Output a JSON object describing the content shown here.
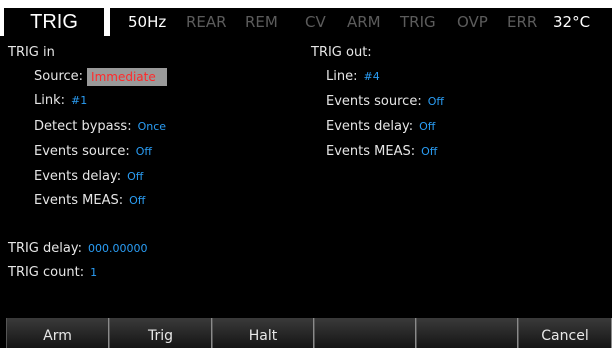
{
  "header": {
    "screen_title": "TRIG",
    "indicators": [
      {
        "label": "50Hz",
        "state": "on"
      },
      {
        "label": "REAR",
        "state": "off"
      },
      {
        "label": "REM",
        "state": "off"
      },
      {
        "label": "CV",
        "state": "off"
      },
      {
        "label": "ARM",
        "state": "off"
      },
      {
        "label": "TRIG",
        "state": "off"
      },
      {
        "label": "OVP",
        "state": "off"
      },
      {
        "label": "ERR",
        "state": "off"
      },
      {
        "label": "32°C",
        "state": "on"
      }
    ]
  },
  "trig_in": {
    "heading": "TRIG in",
    "source": {
      "label": "Source:",
      "value": "Immediate"
    },
    "link": {
      "label": "Link:",
      "value": "#1"
    },
    "detect_bypass": {
      "label": "Detect bypass:",
      "value": "Once"
    },
    "events_source": {
      "label": "Events source:",
      "value": "Off"
    },
    "events_delay": {
      "label": "Events delay:",
      "value": "Off"
    },
    "events_meas": {
      "label": "Events MEAS:",
      "value": "Off"
    }
  },
  "trig_out": {
    "heading": "TRIG out:",
    "line": {
      "label": "Line:",
      "value": "#4"
    },
    "events_source": {
      "label": "Events source:",
      "value": "Off"
    },
    "events_delay": {
      "label": "Events delay:",
      "value": "Off"
    },
    "events_meas": {
      "label": "Events MEAS:",
      "value": "Off"
    }
  },
  "trig_delay": {
    "label": "TRIG delay:",
    "value": "000.00000"
  },
  "trig_count": {
    "label": "TRIG count:",
    "value": "1"
  },
  "softkeys": [
    "Arm",
    "Trig",
    "Halt",
    "",
    "",
    "Cancel"
  ],
  "colors": {
    "value_text": "#2a9df4",
    "selected_field_bg": "#9a9a9a",
    "selected_field_text": "#ff2a2a",
    "inactive_indicator": "#5c5c5c"
  }
}
